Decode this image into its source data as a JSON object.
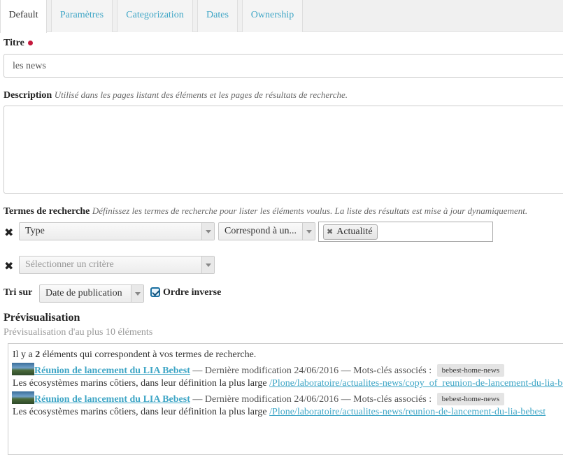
{
  "tabs": [
    "Default",
    "Paramètres",
    "Categorization",
    "Dates",
    "Ownership"
  ],
  "title_field": {
    "label": "Titre",
    "value": "les news"
  },
  "description_field": {
    "label": "Description",
    "help": "Utilisé dans les pages listant des éléments et les pages de résultats de recherche.",
    "value": ""
  },
  "query": {
    "label": "Termes de recherche",
    "help": "Définissez les termes de recherche pour lister les éléments voulus. La liste des résultats est mise à jour dynamiquement.",
    "row1": {
      "criterion": "Type",
      "operator": "Correspond à un...",
      "tag": "Actualité"
    },
    "row2": {
      "placeholder": "Sélectionner un critère"
    }
  },
  "sort": {
    "label": "Tri sur",
    "value": "Date de publication",
    "reverse_label": "Ordre inverse",
    "reverse_checked": true
  },
  "preview": {
    "heading": "Prévisualisation",
    "subheading": "Prévisualisation d'au plus 10 éléments",
    "count_prefix": "Il y a",
    "count": "2",
    "count_suffix": "éléments qui correspondent à vos termes de recherche.",
    "results": [
      {
        "title": "Réunion de lancement du LIA Bebest",
        "meta": "— Dernière modification 24/06/2016 — Mots-clés associés :",
        "keyword": "bebest-home-news",
        "description": "Les écosystèmes marins côtiers, dans leur définition la plus large",
        "path": "/Plone/laboratoire/actualites-news/copy_of_reunion-de-lancement-du-lia-bebest"
      },
      {
        "title": "Réunion de lancement du LIA Bebest",
        "meta": "— Dernière modification 24/06/2016 — Mots-clés associés :",
        "keyword": "bebest-home-news",
        "description": "Les écosystèmes marins côtiers, dans leur définition la plus large",
        "path": "/Plone/laboratoire/actualites-news/reunion-de-lancement-du-lia-bebest"
      }
    ]
  }
}
